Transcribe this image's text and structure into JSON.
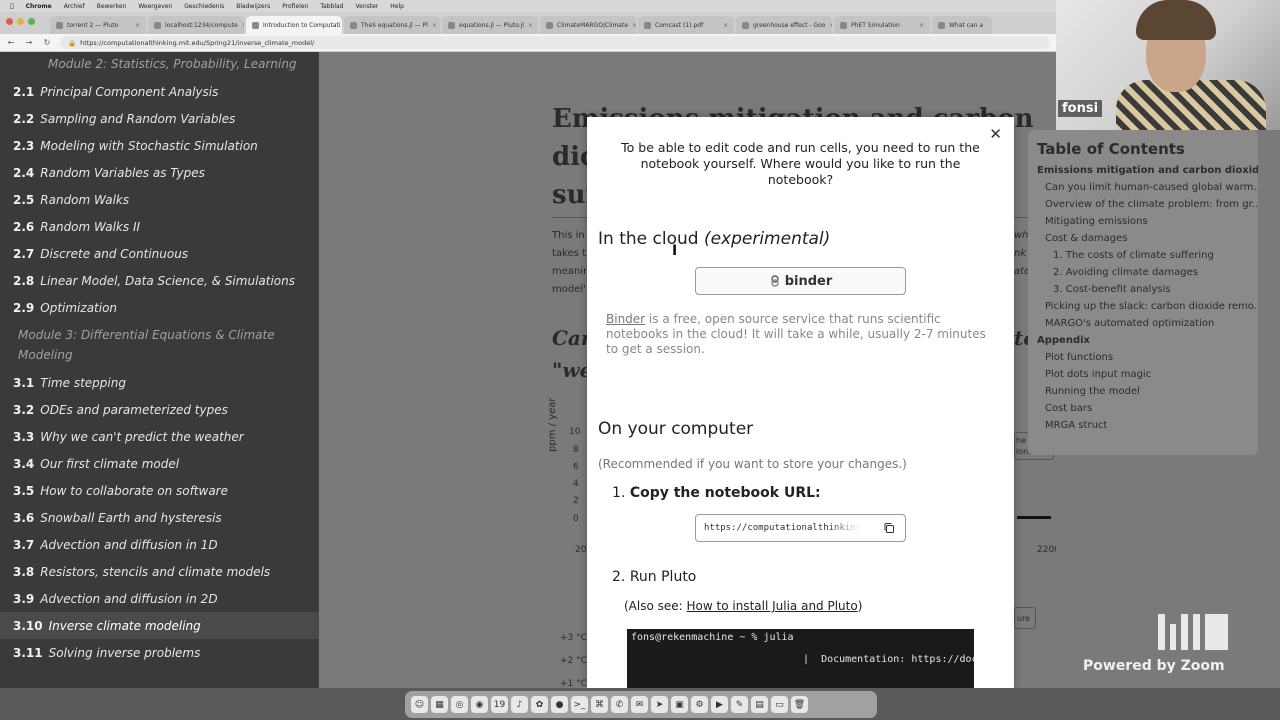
{
  "os_menu": {
    "app": "Chrome",
    "items": [
      "Archief",
      "Bewerken",
      "Weergeven",
      "Geschiedenis",
      "Bladwijzers",
      "Profielen",
      "Tabblad",
      "Venster",
      "Help"
    ]
  },
  "tabs": [
    {
      "label": "torrent 2 — Pluto"
    },
    {
      "label": "localhost:1234/compute"
    },
    {
      "label": "Introduction to Computati"
    },
    {
      "label": "TheS equations.jl — Pl"
    },
    {
      "label": "equations.jl — Pluto.jl"
    },
    {
      "label": "ClimateMARGO/Climate"
    },
    {
      "label": "Comcast (1).pdf"
    },
    {
      "label": "greenhouse effect - Goo"
    },
    {
      "label": "PhET Simulation"
    },
    {
      "label": "What can a"
    }
  ],
  "browser": {
    "url": "https://computationalthinking.mit.edu/Spring21/inverse_climate_model/"
  },
  "sidebar": {
    "module2": "Module 2: Statistics, Probability, Learning",
    "module3": "Module 3: Differential Equations & Climate Modeling",
    "items": [
      {
        "num": "2.1",
        "label": "Principal Component Analysis"
      },
      {
        "num": "2.2",
        "label": "Sampling and Random Variables"
      },
      {
        "num": "2.3",
        "label": "Modeling with Stochastic Simulation"
      },
      {
        "num": "2.4",
        "label": "Random Variables as Types"
      },
      {
        "num": "2.5",
        "label": "Random Walks"
      },
      {
        "num": "2.6",
        "label": "Random Walks II"
      },
      {
        "num": "2.7",
        "label": "Discrete and Continuous"
      },
      {
        "num": "2.8",
        "label": "Linear Model, Data Science, & Simulations"
      },
      {
        "num": "2.9",
        "label": "Optimization"
      },
      {
        "num": "3.1",
        "label": "Time stepping"
      },
      {
        "num": "3.2",
        "label": "ODEs and parameterized types"
      },
      {
        "num": "3.3",
        "label": "Why we can't predict the weather"
      },
      {
        "num": "3.4",
        "label": "Our first climate model"
      },
      {
        "num": "3.5",
        "label": "How to collaborate on software"
      },
      {
        "num": "3.6",
        "label": "Snowball Earth and hysteresis"
      },
      {
        "num": "3.7",
        "label": "Advection and diffusion in 1D"
      },
      {
        "num": "3.8",
        "label": "Resistors, stencils and climate models"
      },
      {
        "num": "3.9",
        "label": "Advection and diffusion in 2D"
      },
      {
        "num": "3.10",
        "label": "Inverse climate modeling"
      },
      {
        "num": "3.11",
        "label": "Solving inverse problems"
      }
    ]
  },
  "notebook_bg": {
    "title_lines": [
      "Emissions mitigation and carbon",
      "dio",
      "suf"
    ],
    "text": [
      "This in",
      "takes t",
      "meanin",
      "model'"
    ],
    "text_right": [
      "who",
      "nk a",
      "ate"
    ],
    "ital_a": "Car",
    "ital_b": "\"we",
    "ital_right": "to",
    "y_label": "ppm / year",
    "y_ticks": [
      "10",
      "8",
      "6",
      "4",
      "2",
      "0"
    ],
    "x_left": "20",
    "x_right": "2200",
    "temp_ticks": [
      "+3 °C",
      "+2 °C",
      "+1 °C"
    ],
    "btn_frag_1": "he",
    "btn_frag_2": "ions",
    "btn_frag_3": "ure"
  },
  "modal": {
    "intro": "To be able to edit code and run cells, you need to run the notebook yourself. Where would you like to run the notebook?",
    "cloud_heading": "In the cloud",
    "cloud_tag": "(experimental)",
    "binder_label": "binder",
    "binder_link": "Binder",
    "binder_desc": " is a free, open source service that runs scientific notebooks in the cloud! It will take a while, usually 2-7 minutes to get a session.",
    "computer_heading": "On your computer",
    "recommended": "(Recommended if you want to store your changes.)",
    "step1": "Copy the notebook URL:",
    "notebook_url": "https://computationalthinking.mit.edu",
    "step2": "Run Pluto",
    "also_see_prefix": "(Also see: ",
    "also_see_link": "How to install Julia and Pluto",
    "also_see_suffix": ")",
    "terminal_prompt": "fons@rekenmachine ~ % julia",
    "terminal_doc": "Documentation: https://docs"
  },
  "toc": {
    "title": "Table of Contents",
    "rows": [
      {
        "label": "Emissions mitigation and carbon dioxide r...",
        "level": 1
      },
      {
        "label": "Can you limit human-caused global warm...",
        "level": 2
      },
      {
        "label": "Overview of the climate problem: from gr...",
        "level": 2
      },
      {
        "label": "Mitigating emissions",
        "level": 2
      },
      {
        "label": "Cost & damages",
        "level": 2
      },
      {
        "label": "1. The costs of climate suffering",
        "level": 3
      },
      {
        "label": "2. Avoiding climate damages",
        "level": 3
      },
      {
        "label": "3. Cost-benefit analysis",
        "level": 3
      },
      {
        "label": "Picking up the slack: carbon dioxide remo...",
        "level": 2
      },
      {
        "label": "MARGO's automated optimization",
        "level": 2
      },
      {
        "label": "Appendix",
        "level": 1
      },
      {
        "label": "Plot functions",
        "level": 2
      },
      {
        "label": "Plot dots input magic",
        "level": 2
      },
      {
        "label": "Running the model",
        "level": 2
      },
      {
        "label": "Cost bars",
        "level": 2
      },
      {
        "label": "MRGA struct",
        "level": 2
      }
    ]
  },
  "webcam": {
    "name": "fonsi"
  },
  "zoom": {
    "powered": "Powered by Zoom"
  },
  "dock": {
    "calendar_day": "19"
  }
}
